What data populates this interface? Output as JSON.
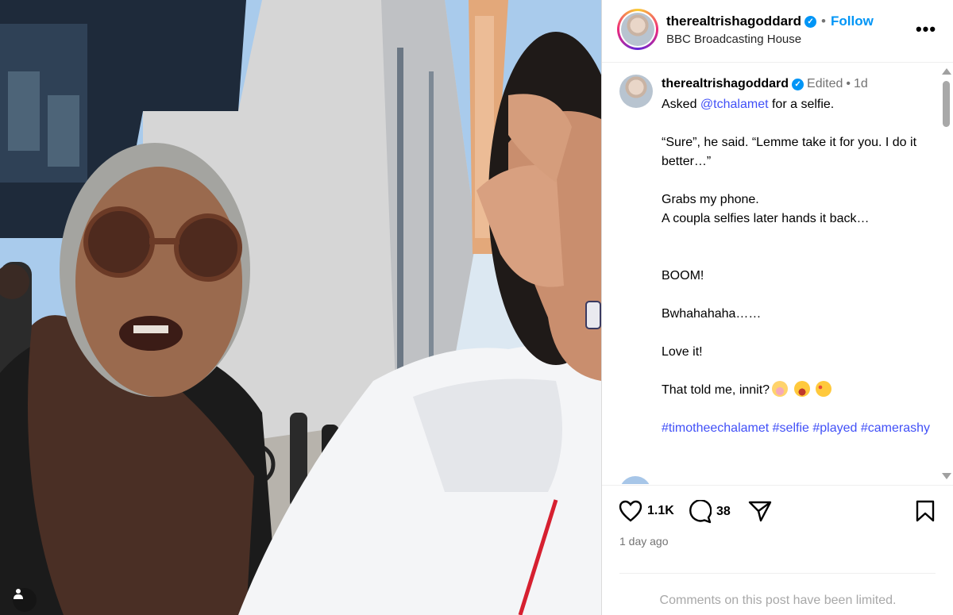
{
  "post": {
    "username": "therealtrishagoddard",
    "follow_label": "Follow",
    "location": "BBC Broadcasting House",
    "more_label": "•••"
  },
  "caption": {
    "username": "therealtrishagoddard",
    "edited": "Edited",
    "age": "1d",
    "line1_prefix": "Asked",
    "mention": "@tchalamet",
    "line1_suffix": "for a selfie.",
    "line2": "“Sure”, he said. “Lemme take it for you. I do it better…”",
    "line3": "Grabs my phone.",
    "line4": "A coupla selfies later hands it back…",
    "line5": "BOOM!",
    "line6": "Bwhahahaha……",
    "line7": "Love it!",
    "line8": "That told me, innit?",
    "hashtags": [
      "#timotheechalamet",
      "#selfie",
      "#played",
      "#camerashy"
    ]
  },
  "actions": {
    "likes": "1.1K",
    "comments": "38",
    "timestamp": "1 day ago",
    "limited_notice": "Comments on this post have been limited."
  },
  "icons": {
    "verified": "verified-badge-icon",
    "like": "heart-icon",
    "comment": "comment-bubble-icon",
    "share": "paper-plane-icon",
    "save": "bookmark-icon",
    "tag": "user-tag-icon"
  },
  "colors": {
    "accent": "#0095f6",
    "hashtag": "#4150f7",
    "muted": "#737373"
  }
}
